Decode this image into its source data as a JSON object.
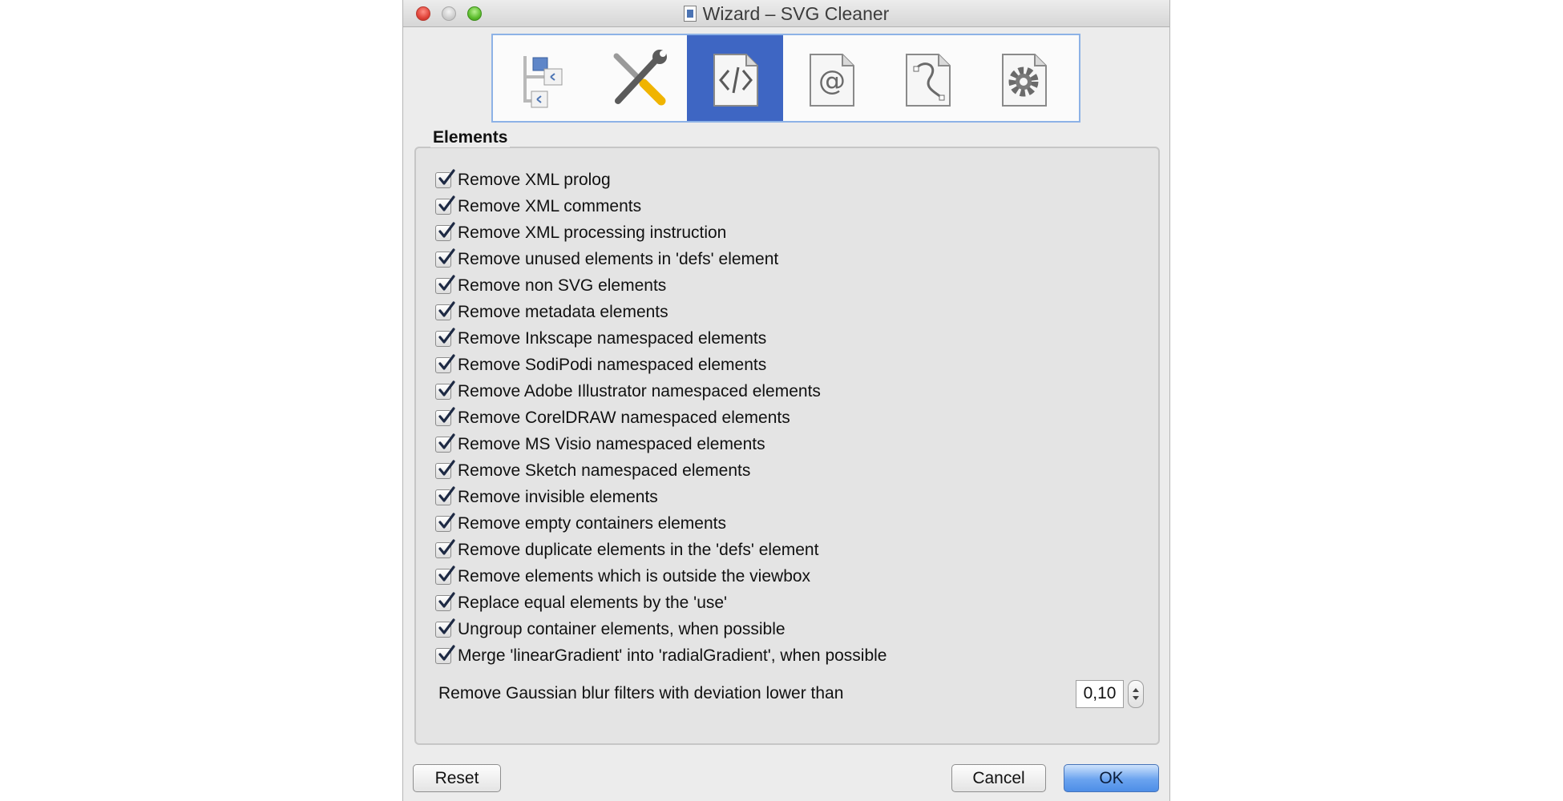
{
  "window": {
    "title": "Wizard – SVG Cleaner"
  },
  "toolbar": {
    "icons": [
      "tree-icon",
      "tools-icon",
      "code-icon",
      "at-icon",
      "path-icon",
      "gear-icon"
    ],
    "active_index": 2,
    "accent_color": "#3e66c3"
  },
  "elements_group": {
    "title": "Elements",
    "options": [
      {
        "label": "Remove XML prolog",
        "checked": true
      },
      {
        "label": "Remove XML comments",
        "checked": true
      },
      {
        "label": "Remove XML processing instruction",
        "checked": true
      },
      {
        "label": "Remove unused elements in 'defs' element",
        "checked": true
      },
      {
        "label": "Remove non SVG elements",
        "checked": true
      },
      {
        "label": "Remove metadata elements",
        "checked": true
      },
      {
        "label": "Remove Inkscape namespaced elements",
        "checked": true
      },
      {
        "label": "Remove SodiPodi namespaced elements",
        "checked": true
      },
      {
        "label": "Remove Adobe Illustrator namespaced elements",
        "checked": true
      },
      {
        "label": "Remove CorelDRAW namespaced elements",
        "checked": true
      },
      {
        "label": "Remove MS Visio namespaced elements",
        "checked": true
      },
      {
        "label": "Remove Sketch namespaced elements",
        "checked": true
      },
      {
        "label": "Remove invisible elements",
        "checked": true
      },
      {
        "label": "Remove empty containers elements",
        "checked": true
      },
      {
        "label": "Remove duplicate elements in the 'defs' element",
        "checked": true
      },
      {
        "label": "Remove elements which is outside the viewbox",
        "checked": true
      },
      {
        "label": "Replace equal elements by the 'use'",
        "checked": true
      },
      {
        "label": "Ungroup container elements, when possible",
        "checked": true
      },
      {
        "label": "Merge 'linearGradient' into 'radialGradient', when possible",
        "checked": true
      }
    ],
    "blur_label": "Remove Gaussian blur filters with deviation lower than",
    "blur_value": "0,10"
  },
  "buttons": {
    "reset": "Reset",
    "cancel": "Cancel",
    "ok": "OK"
  }
}
